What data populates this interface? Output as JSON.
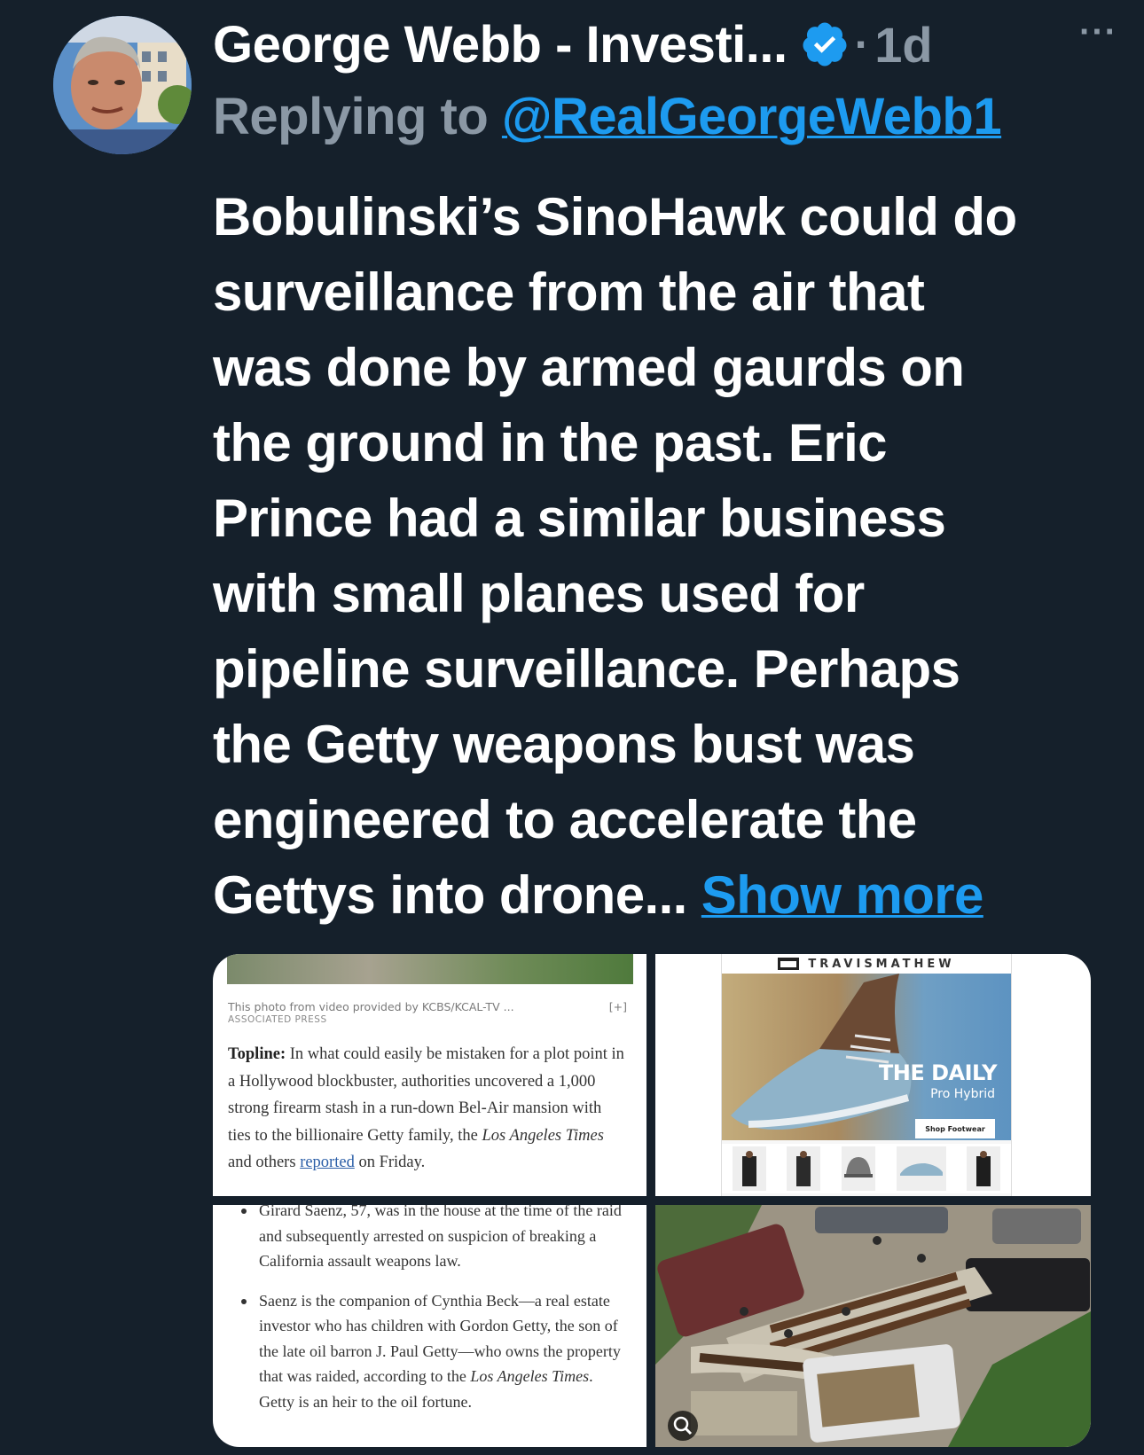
{
  "tweet": {
    "author": "George Webb - Investi...",
    "verified_icon": "verified-badge-icon",
    "separator": "·",
    "time": "1d",
    "more_icon": "···",
    "reply_label": "Replying to",
    "reply_handle": "@RealGeorgeWebb1",
    "text_lines": [
      "Bobulinski’s SinoHawk could do",
      "surveillance from the air that",
      "was done by armed gaurds on",
      "the ground in the past. Eric",
      "Prince had a similar business",
      "with small planes used for",
      "pipeline surveillance. Perhaps",
      "the Getty weapons bust was",
      "engineered to accelerate the",
      "Gettys into drone..."
    ],
    "show_more": "Show more",
    "colors": {
      "background": "#15202b",
      "link": "#1d9bf0",
      "muted": "#8b98a5"
    }
  },
  "media": {
    "panel1": {
      "caption": "This photo from video provided by KCBS/KCAL-TV ...",
      "caption_expand": "[+]",
      "caption_source": "ASSOCIATED PRESS",
      "topline_label": "Topline:",
      "text_a": "In what could easily be mistaken for a plot point in a Hollywood blockbuster, authorities uncovered a 1,000 strong firearm stash in a run-down Bel-Air mansion with ties to the billionaire Getty family, the",
      "text_italic": "Los Angeles Times",
      "text_b": "and others",
      "link_text": "reported",
      "text_c": "on Friday."
    },
    "panel2": {
      "brand": "TRAVISMATHEW",
      "headline": "THE DAILY",
      "subhead": "Pro Hybrid",
      "button": "Shop Footwear"
    },
    "panel3": {
      "bullet1": "Girard Saenz, 57, was in the house at the time of the raid and subsequently arrested on suspicion of breaking a California assault weapons law.",
      "bullet2_a": "Saenz is the companion of Cynthia Beck—a real estate investor who has children with Gordon Getty, the son of the late oil barron J. Paul Getty—who owns the property that was raided, according to the",
      "bullet2_italic": "Los Angeles Times",
      "bullet2_b": ". Getty is an heir to the oil fortune."
    },
    "panel4": {
      "image": "aerial photo of seized firearms laid out on tarps in a driveway",
      "zoom_icon": "zoom-lens-icon"
    }
  }
}
